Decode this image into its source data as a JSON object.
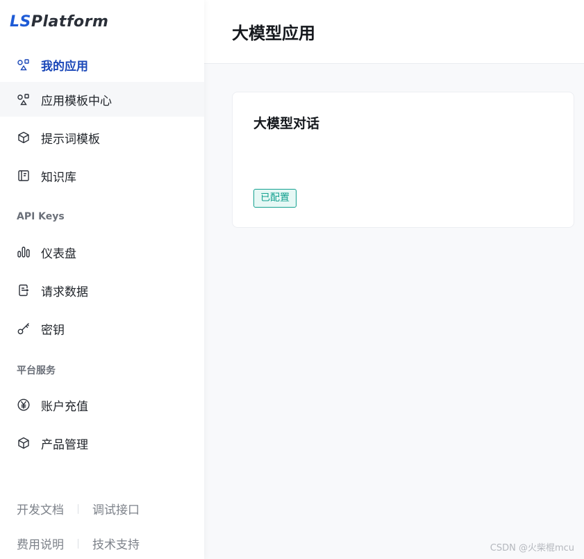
{
  "brand": {
    "prefix": "LS",
    "suffix": "Platform"
  },
  "sidebar": {
    "items": [
      {
        "label": "我的应用",
        "icon": "apps-icon"
      },
      {
        "label": "应用模板中心",
        "icon": "apps-icon"
      },
      {
        "label": "提示词模板",
        "icon": "cube-icon"
      },
      {
        "label": "知识库",
        "icon": "book-icon"
      }
    ],
    "section_api": "API Keys",
    "api_items": [
      {
        "label": "仪表盘",
        "icon": "bar-chart-icon"
      },
      {
        "label": "请求数据",
        "icon": "document-export-icon"
      },
      {
        "label": "密钥",
        "icon": "key-icon"
      }
    ],
    "section_platform": "平台服务",
    "platform_items": [
      {
        "label": "账户充值",
        "icon": "yen-icon"
      },
      {
        "label": "产品管理",
        "icon": "cube-icon"
      }
    ],
    "footer": {
      "row1": [
        "开发文档",
        "调试接口"
      ],
      "row2": [
        "费用说明",
        "技术支持"
      ]
    }
  },
  "header": {
    "title": "大模型应用"
  },
  "card": {
    "title": "大模型对话",
    "badge": "已配置"
  },
  "watermark": "CSDN @火柴棍mcu",
  "colors": {
    "accent": "#1a47b8",
    "badge": "#13a08f",
    "badge_bg": "#e6f8f5"
  }
}
